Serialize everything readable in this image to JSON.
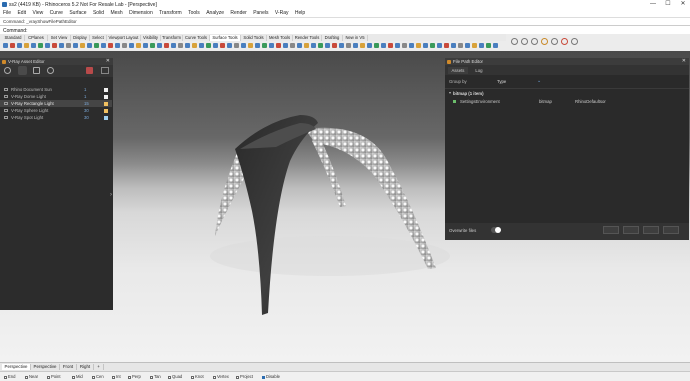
{
  "window": {
    "title": "ss2 (4419 KB) - Rhinoceros 5.2 Not For Resale Lab - [Perspective]",
    "minimize": "—",
    "maximize": "☐",
    "close": "✕"
  },
  "menu": [
    "File",
    "Edit",
    "View",
    "Curve",
    "Surface",
    "Solid",
    "Mesh",
    "Dimension",
    "Transform",
    "Tools",
    "Analyze",
    "Render",
    "Panels",
    "V-Ray",
    "Help"
  ],
  "command": {
    "history": "Command: _vrayShowFilePathEditor",
    "label": "Command:",
    "value": ""
  },
  "toolbar_tabs": [
    "Standard",
    "CPlanes",
    "Set View",
    "Display",
    "Select",
    "Viewport Layout",
    "Visibility",
    "Transform",
    "Curve Tools",
    "Surface Tools",
    "Solid Tools",
    "Mesh Tools",
    "Render Tools",
    "Drafting",
    "New in V5"
  ],
  "toolbar_active_tab": "Surface Tools",
  "asset_editor": {
    "title": "V-Ray Asset Editor",
    "close": "✕",
    "items": [
      {
        "name": "Rhino Document Sun",
        "count": "1",
        "swatch": "#f2f2f2"
      },
      {
        "name": "V-Ray Dome Light",
        "count": "1",
        "swatch": "#f2f2f2"
      },
      {
        "name": "V-Ray Rectangle Light",
        "count": "15",
        "swatch": "#f0c060"
      },
      {
        "name": "V-Ray Sphere Light",
        "count": "30",
        "swatch": "#f0c060"
      },
      {
        "name": "V-Ray Spot Light",
        "count": "30",
        "swatch": "#9fd0f0"
      }
    ],
    "selected_index": 2
  },
  "file_path_editor": {
    "title": "File Path Editor",
    "close": "✕",
    "tabs": [
      "Assets",
      "Log"
    ],
    "group_by_label": "Group by",
    "group_by_value": "Type",
    "group_header": "bitmap (1 item)",
    "rows": [
      {
        "name": "SettingsEnvironment",
        "type": "bitmap",
        "path": "RhinoDefaultsor"
      }
    ],
    "overwrite_label": "Overwrite files"
  },
  "viewport_tabs": [
    "Perspective",
    "Perspective",
    "Front",
    "Right"
  ],
  "viewport_add": "+",
  "osnap": [
    {
      "label": "End",
      "on": false
    },
    {
      "label": "Near",
      "on": false
    },
    {
      "label": "Point",
      "on": false
    },
    {
      "label": "Mid",
      "on": false
    },
    {
      "label": "Cen",
      "on": false
    },
    {
      "label": "Int",
      "on": false
    },
    {
      "label": "Perp",
      "on": false
    },
    {
      "label": "Tan",
      "on": false
    },
    {
      "label": "Quad",
      "on": false
    },
    {
      "label": "Knot",
      "on": false
    },
    {
      "label": "Vertex",
      "on": false
    },
    {
      "label": "Project",
      "on": false
    },
    {
      "label": "Disable",
      "on": true
    }
  ]
}
